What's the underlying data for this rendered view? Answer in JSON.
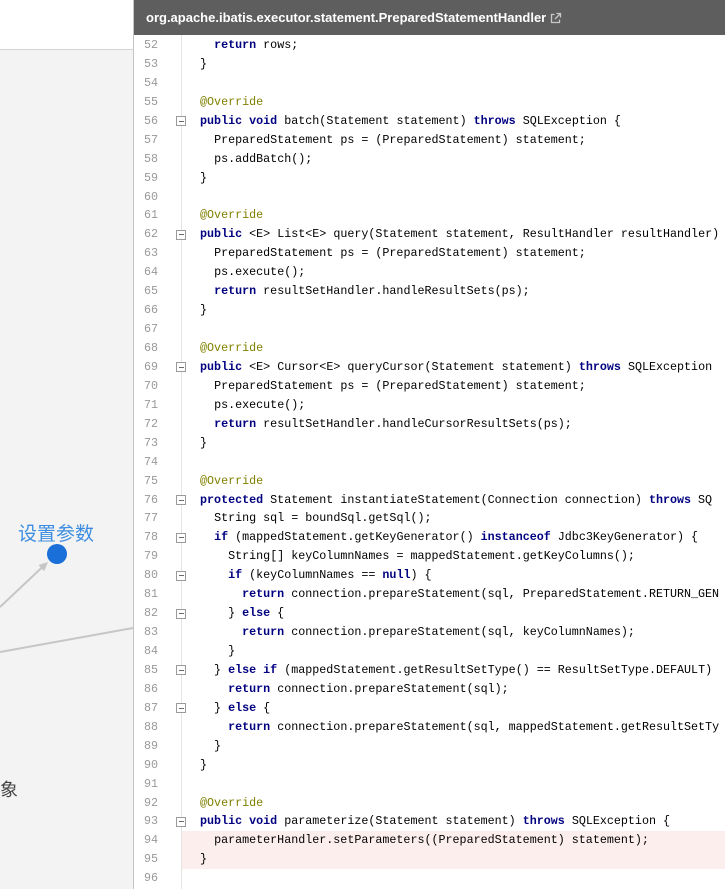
{
  "diagram": {
    "node_label": "设置参数",
    "partial_label": "象",
    "node_color": "#1a6fd8",
    "label_color": "#3d8ee0",
    "edge_color": "#c6c6c6"
  },
  "code_panel": {
    "title": "org.apache.ibatis.executor.statement.PreparedStatementHandler",
    "title_icon": "external-link-icon",
    "header_color": "#5e5e5e",
    "keyword_color": "#000080",
    "annotation_color": "#808000",
    "line_number_color": "#999999",
    "highlight_color": "#fdeeee",
    "lines": [
      {
        "n": 52,
        "code": "    return rows;"
      },
      {
        "n": 53,
        "code": "  }"
      },
      {
        "n": 54,
        "code": ""
      },
      {
        "n": 55,
        "code": "  @Override"
      },
      {
        "n": 56,
        "code": "  public void batch(Statement statement) throws SQLException {",
        "fold": true
      },
      {
        "n": 57,
        "code": "    PreparedStatement ps = (PreparedStatement) statement;"
      },
      {
        "n": 58,
        "code": "    ps.addBatch();"
      },
      {
        "n": 59,
        "code": "  }"
      },
      {
        "n": 60,
        "code": ""
      },
      {
        "n": 61,
        "code": "  @Override"
      },
      {
        "n": 62,
        "code": "  public <E> List<E> query(Statement statement, ResultHandler resultHandler)",
        "fold": true
      },
      {
        "n": 63,
        "code": "    PreparedStatement ps = (PreparedStatement) statement;"
      },
      {
        "n": 64,
        "code": "    ps.execute();"
      },
      {
        "n": 65,
        "code": "    return resultSetHandler.handleResultSets(ps);"
      },
      {
        "n": 66,
        "code": "  }"
      },
      {
        "n": 67,
        "code": ""
      },
      {
        "n": 68,
        "code": "  @Override"
      },
      {
        "n": 69,
        "code": "  public <E> Cursor<E> queryCursor(Statement statement) throws SQLException",
        "fold": true
      },
      {
        "n": 70,
        "code": "    PreparedStatement ps = (PreparedStatement) statement;"
      },
      {
        "n": 71,
        "code": "    ps.execute();"
      },
      {
        "n": 72,
        "code": "    return resultSetHandler.handleCursorResultSets(ps);"
      },
      {
        "n": 73,
        "code": "  }"
      },
      {
        "n": 74,
        "code": ""
      },
      {
        "n": 75,
        "code": "  @Override"
      },
      {
        "n": 76,
        "code": "  protected Statement instantiateStatement(Connection connection) throws SQ",
        "fold": true
      },
      {
        "n": 77,
        "code": "    String sql = boundSql.getSql();"
      },
      {
        "n": 78,
        "code": "    if (mappedStatement.getKeyGenerator() instanceof Jdbc3KeyGenerator) {",
        "fold": true
      },
      {
        "n": 79,
        "code": "      String[] keyColumnNames = mappedStatement.getKeyColumns();"
      },
      {
        "n": 80,
        "code": "      if (keyColumnNames == null) {",
        "fold": true
      },
      {
        "n": 81,
        "code": "        return connection.prepareStatement(sql, PreparedStatement.RETURN_GEN"
      },
      {
        "n": 82,
        "code": "      } else {",
        "fold": true
      },
      {
        "n": 83,
        "code": "        return connection.prepareStatement(sql, keyColumnNames);"
      },
      {
        "n": 84,
        "code": "      }"
      },
      {
        "n": 85,
        "code": "    } else if (mappedStatement.getResultSetType() == ResultSetType.DEFAULT)",
        "fold": true
      },
      {
        "n": 86,
        "code": "      return connection.prepareStatement(sql);"
      },
      {
        "n": 87,
        "code": "    } else {",
        "fold": true
      },
      {
        "n": 88,
        "code": "      return connection.prepareStatement(sql, mappedStatement.getResultSetTy"
      },
      {
        "n": 89,
        "code": "    }"
      },
      {
        "n": 90,
        "code": "  }"
      },
      {
        "n": 91,
        "code": ""
      },
      {
        "n": 92,
        "code": "  @Override"
      },
      {
        "n": 93,
        "code": "  public void parameterize(Statement statement) throws SQLException {",
        "fold": true
      },
      {
        "n": 94,
        "code": "    parameterHandler.setParameters((PreparedStatement) statement);",
        "hl": true
      },
      {
        "n": 95,
        "code": "  }",
        "hl": true
      },
      {
        "n": 96,
        "code": ""
      }
    ]
  }
}
